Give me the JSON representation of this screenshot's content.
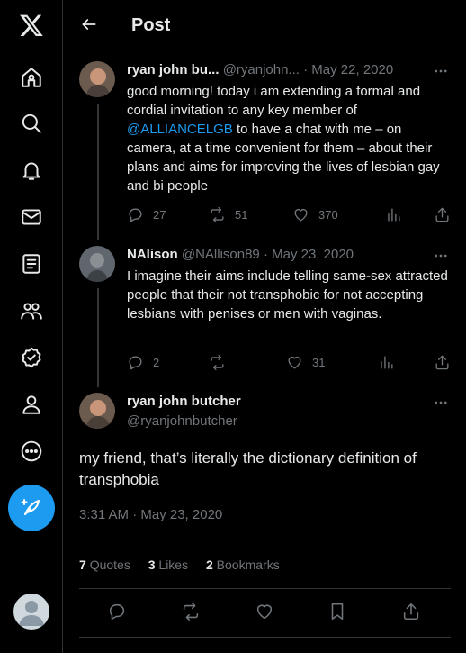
{
  "nav": {
    "items": [
      "x-logo",
      "home",
      "explore",
      "notifications",
      "messages",
      "lists",
      "communities",
      "verified",
      "profile",
      "more"
    ]
  },
  "header": {
    "title": "Post"
  },
  "thread": [
    {
      "name": "ryan john bu...",
      "handle": "@ryanjohn...",
      "date": "· May 22, 2020",
      "text_before": "good morning! today i am extending a formal and cordial invitation to any key member of ",
      "mention": "@ALLIANCELGB",
      "text_after": " to have a chat with me – on camera, at a time convenient for them – about their plans and aims for improving the lives of lesbian gay and bi people",
      "replies": "27",
      "reposts": "51",
      "likes": "370"
    },
    {
      "name": "NAlison",
      "handle": "@NAllison89",
      "date": "· May 23, 2020",
      "text": "I imagine their aims include telling same-sex attracted people that their not transphobic for not accepting lesbians with penises or men with vaginas.",
      "replies": "2",
      "reposts": "",
      "likes": "31"
    }
  ],
  "focus": {
    "name": "ryan john butcher",
    "handle": "@ryanjohnbutcher",
    "text": "my friend, that’s literally the dictionary definition of transphobia",
    "timestamp": "3:31 AM · May 23, 2020",
    "quotes_count": "7",
    "quotes_label": "Quotes",
    "likes_count": "3",
    "likes_label": "Likes",
    "bookmarks_count": "2",
    "bookmarks_label": "Bookmarks"
  },
  "colors": {
    "accent": "#1d9bf0",
    "muted": "#71767b",
    "text": "#e7e9ea",
    "background": "#000000",
    "border": "#2f3336"
  }
}
